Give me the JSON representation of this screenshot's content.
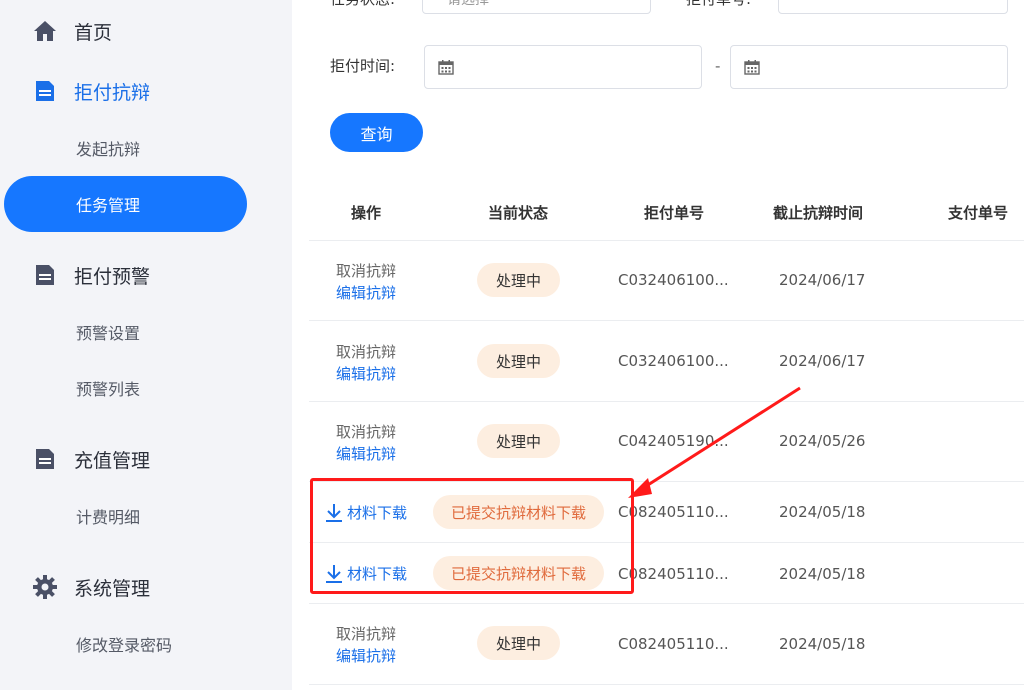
{
  "sidebar": {
    "groups": [
      {
        "label": "首页",
        "icon": "home-icon"
      },
      {
        "label": "拒付抗辩",
        "icon": "document-icon"
      },
      {
        "label": "拒付预警",
        "icon": "document-icon"
      },
      {
        "label": "充值管理",
        "icon": "document-icon"
      },
      {
        "label": "系统管理",
        "icon": "gear-icon"
      }
    ],
    "subs": {
      "launch": "发起抗辩",
      "tasks": "任务管理",
      "warn_settings": "预警设置",
      "warn_list": "预警列表",
      "billing": "计费明细",
      "password": "修改登录密码"
    }
  },
  "filters": {
    "status_label": "任务状态:",
    "status_placeholder": "请选择",
    "refuse_no_label": "拒付单号:",
    "time_label": "拒付时间:",
    "separator": "-",
    "query_button": "查询"
  },
  "table": {
    "headers": [
      "操作",
      "当前状态",
      "拒付单号",
      "截止抗辩时间",
      "支付单号"
    ],
    "rows": [
      {
        "op1": "取消抗辩",
        "op2": "编辑抗辩",
        "status": "处理中",
        "order": "C032406100...",
        "deadline": "2024/06/17"
      },
      {
        "op1": "取消抗辩",
        "op2": "编辑抗辩",
        "status": "处理中",
        "order": "C032406100...",
        "deadline": "2024/06/17"
      },
      {
        "op1": "取消抗辩",
        "op2": "编辑抗辩",
        "status": "处理中",
        "order": "C042405190...",
        "deadline": "2024/05/26"
      },
      {
        "download": "材料下载",
        "status": "已提交抗辩材料下载",
        "order": "C082405110...",
        "deadline": "2024/05/18"
      },
      {
        "download": "材料下载",
        "status": "已提交抗辩材料下载",
        "order": "C082405110...",
        "deadline": "2024/05/18"
      },
      {
        "op1": "取消抗辩",
        "op2": "编辑抗辩",
        "status": "处理中",
        "order": "C082405110...",
        "deadline": "2024/05/18"
      }
    ]
  },
  "colors": {
    "accent": "#1677ff",
    "pill_bg": "#fdeee0",
    "pill_text": "#e06a3c",
    "annotation_red": "#ff1a1a"
  }
}
